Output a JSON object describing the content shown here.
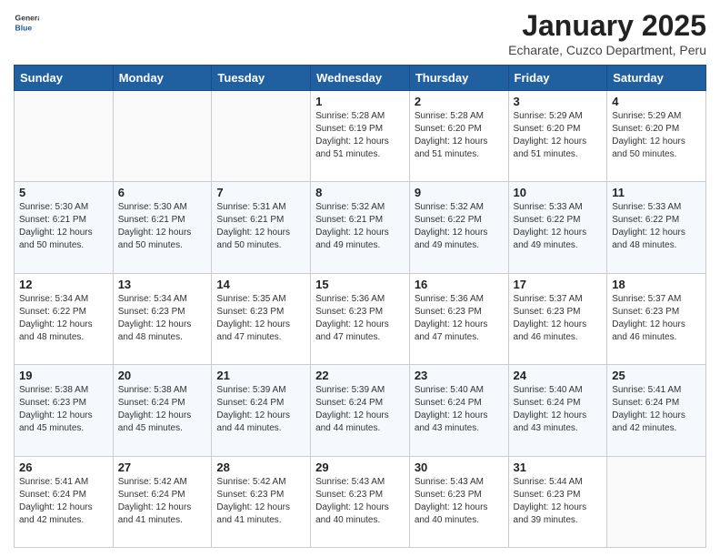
{
  "logo": {
    "text_general": "General",
    "text_blue": "Blue"
  },
  "header": {
    "title": "January 2025",
    "subtitle": "Echarate, Cuzco Department, Peru"
  },
  "days_of_week": [
    "Sunday",
    "Monday",
    "Tuesday",
    "Wednesday",
    "Thursday",
    "Friday",
    "Saturday"
  ],
  "weeks": [
    [
      {
        "day": "",
        "info": ""
      },
      {
        "day": "",
        "info": ""
      },
      {
        "day": "",
        "info": ""
      },
      {
        "day": "1",
        "info": "Sunrise: 5:28 AM\nSunset: 6:19 PM\nDaylight: 12 hours\nand 51 minutes."
      },
      {
        "day": "2",
        "info": "Sunrise: 5:28 AM\nSunset: 6:20 PM\nDaylight: 12 hours\nand 51 minutes."
      },
      {
        "day": "3",
        "info": "Sunrise: 5:29 AM\nSunset: 6:20 PM\nDaylight: 12 hours\nand 51 minutes."
      },
      {
        "day": "4",
        "info": "Sunrise: 5:29 AM\nSunset: 6:20 PM\nDaylight: 12 hours\nand 50 minutes."
      }
    ],
    [
      {
        "day": "5",
        "info": "Sunrise: 5:30 AM\nSunset: 6:21 PM\nDaylight: 12 hours\nand 50 minutes."
      },
      {
        "day": "6",
        "info": "Sunrise: 5:30 AM\nSunset: 6:21 PM\nDaylight: 12 hours\nand 50 minutes."
      },
      {
        "day": "7",
        "info": "Sunrise: 5:31 AM\nSunset: 6:21 PM\nDaylight: 12 hours\nand 50 minutes."
      },
      {
        "day": "8",
        "info": "Sunrise: 5:32 AM\nSunset: 6:21 PM\nDaylight: 12 hours\nand 49 minutes."
      },
      {
        "day": "9",
        "info": "Sunrise: 5:32 AM\nSunset: 6:22 PM\nDaylight: 12 hours\nand 49 minutes."
      },
      {
        "day": "10",
        "info": "Sunrise: 5:33 AM\nSunset: 6:22 PM\nDaylight: 12 hours\nand 49 minutes."
      },
      {
        "day": "11",
        "info": "Sunrise: 5:33 AM\nSunset: 6:22 PM\nDaylight: 12 hours\nand 48 minutes."
      }
    ],
    [
      {
        "day": "12",
        "info": "Sunrise: 5:34 AM\nSunset: 6:22 PM\nDaylight: 12 hours\nand 48 minutes."
      },
      {
        "day": "13",
        "info": "Sunrise: 5:34 AM\nSunset: 6:23 PM\nDaylight: 12 hours\nand 48 minutes."
      },
      {
        "day": "14",
        "info": "Sunrise: 5:35 AM\nSunset: 6:23 PM\nDaylight: 12 hours\nand 47 minutes."
      },
      {
        "day": "15",
        "info": "Sunrise: 5:36 AM\nSunset: 6:23 PM\nDaylight: 12 hours\nand 47 minutes."
      },
      {
        "day": "16",
        "info": "Sunrise: 5:36 AM\nSunset: 6:23 PM\nDaylight: 12 hours\nand 47 minutes."
      },
      {
        "day": "17",
        "info": "Sunrise: 5:37 AM\nSunset: 6:23 PM\nDaylight: 12 hours\nand 46 minutes."
      },
      {
        "day": "18",
        "info": "Sunrise: 5:37 AM\nSunset: 6:23 PM\nDaylight: 12 hours\nand 46 minutes."
      }
    ],
    [
      {
        "day": "19",
        "info": "Sunrise: 5:38 AM\nSunset: 6:23 PM\nDaylight: 12 hours\nand 45 minutes."
      },
      {
        "day": "20",
        "info": "Sunrise: 5:38 AM\nSunset: 6:24 PM\nDaylight: 12 hours\nand 45 minutes."
      },
      {
        "day": "21",
        "info": "Sunrise: 5:39 AM\nSunset: 6:24 PM\nDaylight: 12 hours\nand 44 minutes."
      },
      {
        "day": "22",
        "info": "Sunrise: 5:39 AM\nSunset: 6:24 PM\nDaylight: 12 hours\nand 44 minutes."
      },
      {
        "day": "23",
        "info": "Sunrise: 5:40 AM\nSunset: 6:24 PM\nDaylight: 12 hours\nand 43 minutes."
      },
      {
        "day": "24",
        "info": "Sunrise: 5:40 AM\nSunset: 6:24 PM\nDaylight: 12 hours\nand 43 minutes."
      },
      {
        "day": "25",
        "info": "Sunrise: 5:41 AM\nSunset: 6:24 PM\nDaylight: 12 hours\nand 42 minutes."
      }
    ],
    [
      {
        "day": "26",
        "info": "Sunrise: 5:41 AM\nSunset: 6:24 PM\nDaylight: 12 hours\nand 42 minutes."
      },
      {
        "day": "27",
        "info": "Sunrise: 5:42 AM\nSunset: 6:24 PM\nDaylight: 12 hours\nand 41 minutes."
      },
      {
        "day": "28",
        "info": "Sunrise: 5:42 AM\nSunset: 6:23 PM\nDaylight: 12 hours\nand 41 minutes."
      },
      {
        "day": "29",
        "info": "Sunrise: 5:43 AM\nSunset: 6:23 PM\nDaylight: 12 hours\nand 40 minutes."
      },
      {
        "day": "30",
        "info": "Sunrise: 5:43 AM\nSunset: 6:23 PM\nDaylight: 12 hours\nand 40 minutes."
      },
      {
        "day": "31",
        "info": "Sunrise: 5:44 AM\nSunset: 6:23 PM\nDaylight: 12 hours\nand 39 minutes."
      },
      {
        "day": "",
        "info": ""
      }
    ]
  ]
}
